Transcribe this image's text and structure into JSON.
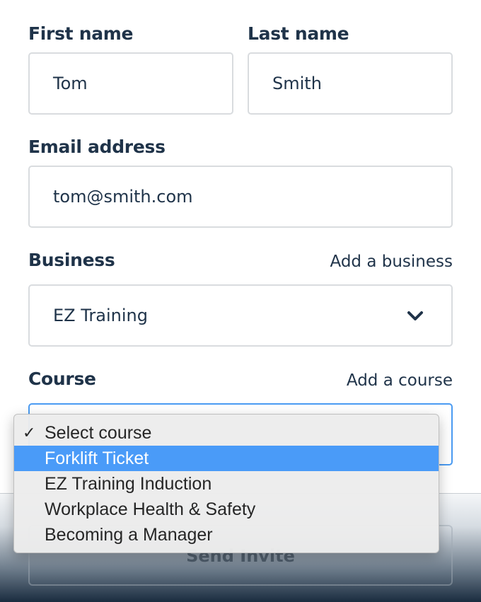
{
  "form": {
    "first_name": {
      "label": "First name",
      "value": "Tom"
    },
    "last_name": {
      "label": "Last name",
      "value": "Smith"
    },
    "email": {
      "label": "Email address",
      "value": "tom@smith.com"
    },
    "business": {
      "label": "Business",
      "add_link": "Add a business",
      "value": "EZ Training",
      "icon": "chevron-down-icon"
    },
    "course": {
      "label": "Course",
      "add_link": "Add a course"
    }
  },
  "dropdown": {
    "options": [
      {
        "label": "Select course",
        "checked": true
      },
      {
        "label": "Forklift Ticket",
        "highlighted": true
      },
      {
        "label": "EZ Training Induction"
      },
      {
        "label": "Workplace Health & Safety"
      },
      {
        "label": "Becoming a Manager"
      }
    ],
    "check_glyph": "✓",
    "highlight_color": "#4a9bf8"
  },
  "footer": {
    "send_label": "Send Invite"
  },
  "colors": {
    "text": "#1f3349",
    "border": "#d9dcdf",
    "focus_border": "#4a9bf2"
  }
}
